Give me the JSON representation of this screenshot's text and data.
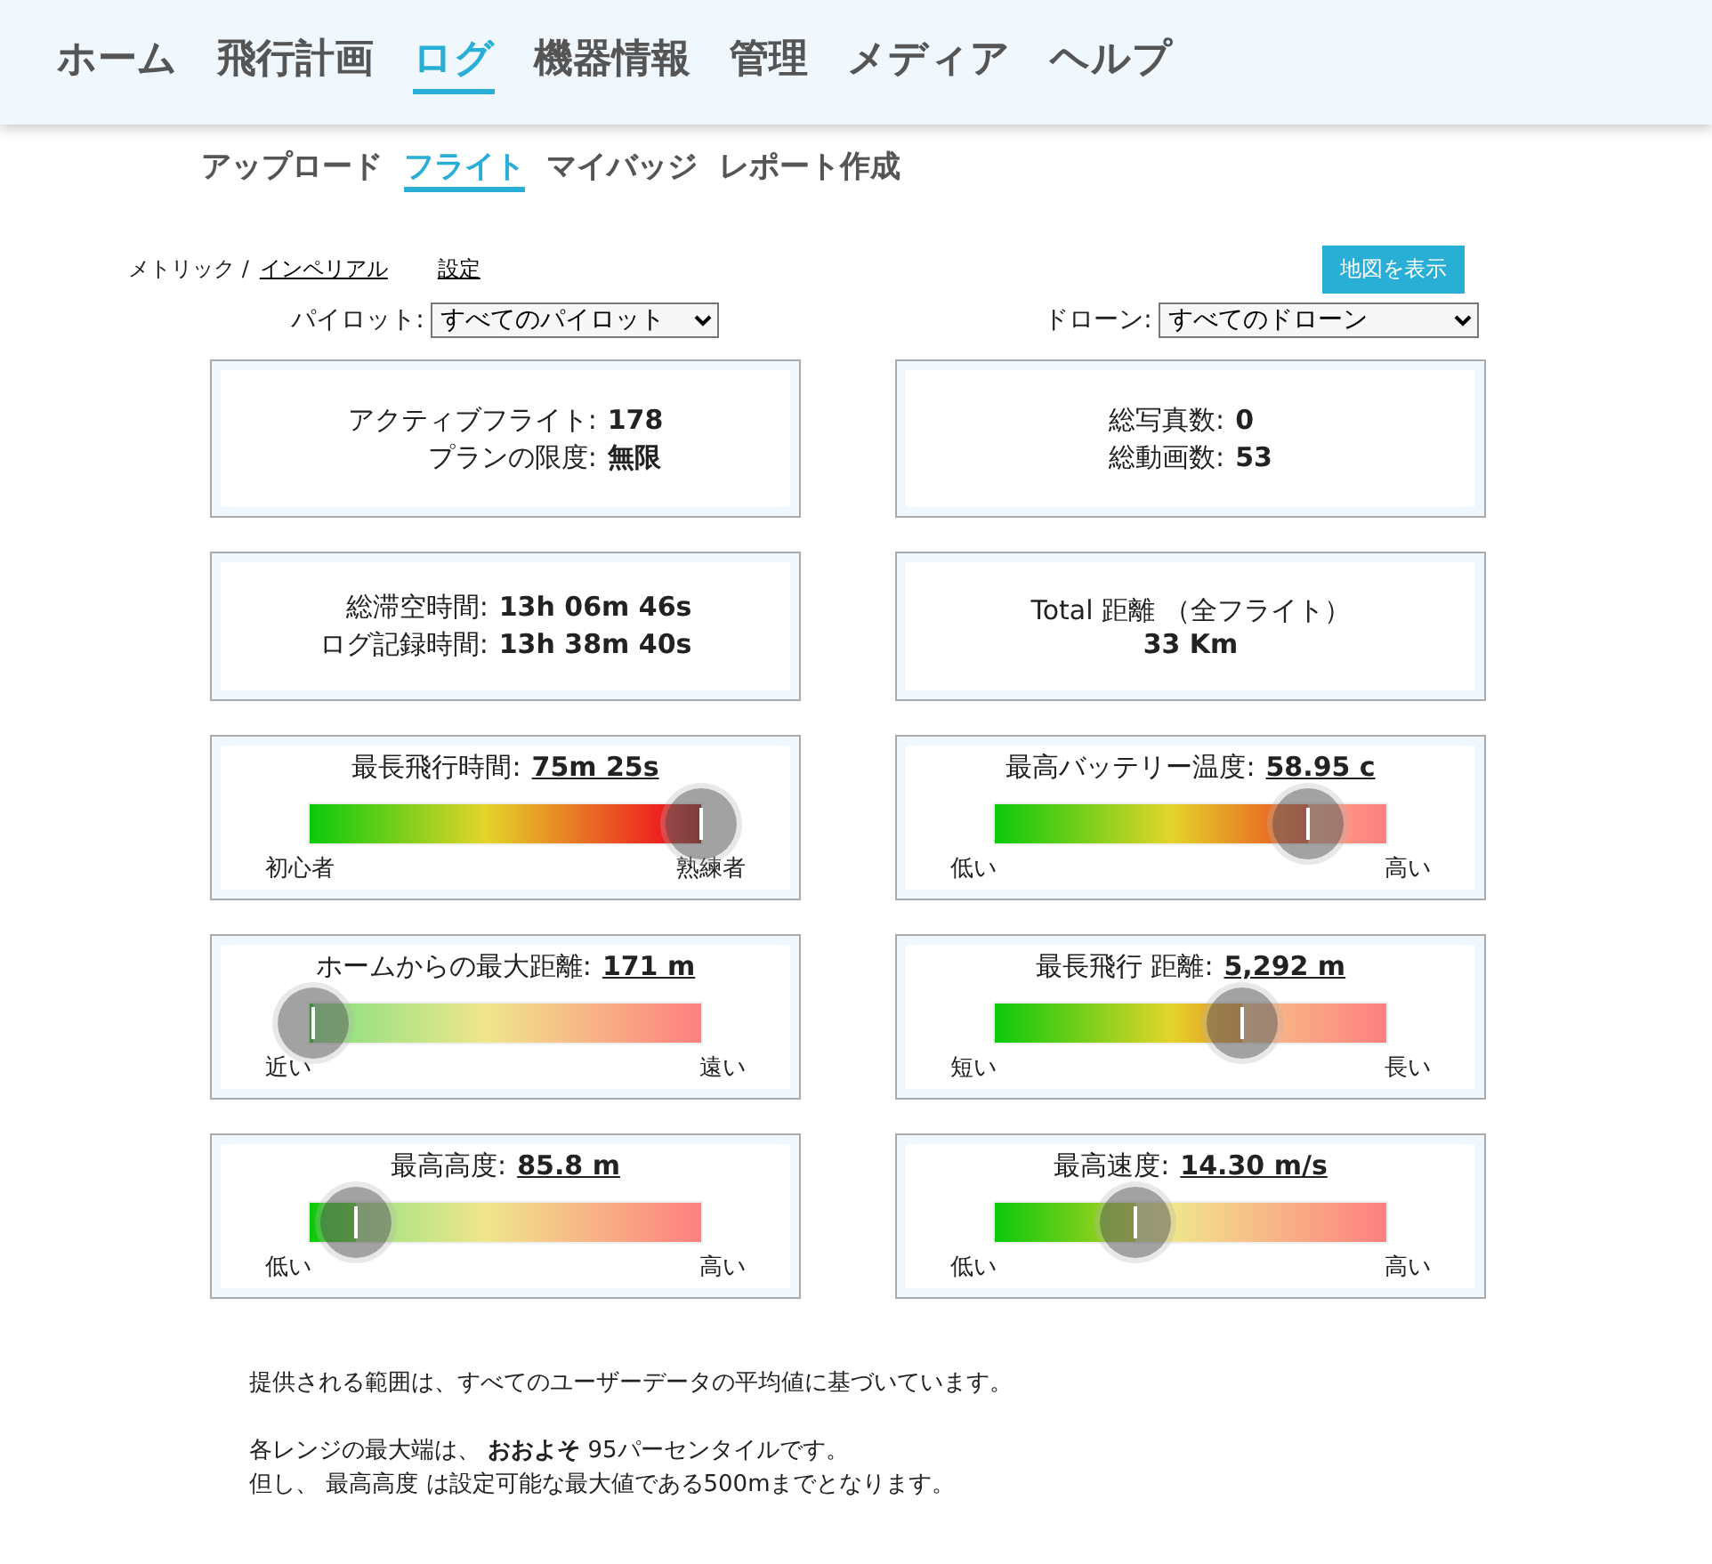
{
  "nav": [
    {
      "label": "ホーム",
      "selected": false
    },
    {
      "label": "飛行計画",
      "selected": false
    },
    {
      "label": "ログ",
      "selected": true
    },
    {
      "label": "機器情報",
      "selected": false
    },
    {
      "label": "管理",
      "selected": false
    },
    {
      "label": "メディア",
      "selected": false
    },
    {
      "label": "ヘルプ",
      "selected": false
    }
  ],
  "subnav": [
    {
      "label": "アップロード",
      "selected": false
    },
    {
      "label": "フライト",
      "selected": true
    },
    {
      "label": "マイバッジ",
      "selected": false
    },
    {
      "label": "レポート作成",
      "selected": false
    }
  ],
  "units": {
    "metric": "メトリック /",
    "imperial": "インペリアル",
    "settings": "設定"
  },
  "map_button": "地図を表示",
  "filters": [
    {
      "label": "パイロット:",
      "value": "すべてのパイロット"
    },
    {
      "label": "ドローン:",
      "value": "すべてのドローン"
    }
  ],
  "cards": [
    {
      "kind": "stats",
      "rows": [
        {
          "label": "アクティブフライト:",
          "value": "178"
        },
        {
          "label": "プランの限度:",
          "value": "無限"
        }
      ]
    },
    {
      "kind": "stats",
      "rows": [
        {
          "label": "総写真数:",
          "value": "0"
        },
        {
          "label": "総動画数:",
          "value": "53"
        }
      ]
    },
    {
      "kind": "stats",
      "rows": [
        {
          "label": "総滞空時間:",
          "value": "13h 06m 46s"
        },
        {
          "label": "ログ記録時間:",
          "value": "13h 38m 40s"
        }
      ]
    },
    {
      "kind": "total",
      "title": "Total 距離 （全フライト）",
      "value": "33 Km"
    },
    {
      "kind": "gauge",
      "title": "最長飛行時間:",
      "value": "75m 25s",
      "level": 1.0,
      "low": "初心者",
      "high": "熟練者"
    },
    {
      "kind": "gauge",
      "title": "最高バッテリー温度:",
      "value": "58.95 c",
      "level": 0.8,
      "low": "低い",
      "high": "高い"
    },
    {
      "kind": "gauge",
      "title": "ホームからの最大距離:",
      "value": "171 m",
      "level": 0.01,
      "low": "近い",
      "high": "遠い"
    },
    {
      "kind": "gauge",
      "title": "最長飛行 距離:",
      "value": "5,292 m",
      "level": 0.63,
      "low": "短い",
      "high": "長い"
    },
    {
      "kind": "gauge",
      "title": "最高高度:",
      "value": "85.8 m",
      "level": 0.12,
      "low": "低い",
      "high": "高い"
    },
    {
      "kind": "gauge",
      "title": "最高速度:",
      "value": "14.30 m/s",
      "level": 0.36,
      "low": "低い",
      "high": "高い"
    }
  ],
  "notes": [
    [
      "提供される範囲は、すべてのユーザーデータの平均値に基づいています。"
    ],
    [
      "各レンジの最大端は、 **おおよそ** 95パーセンタイルです。",
      "但し、 最高高度 は設定可能な最大値である500mまでとなります。"
    ]
  ]
}
